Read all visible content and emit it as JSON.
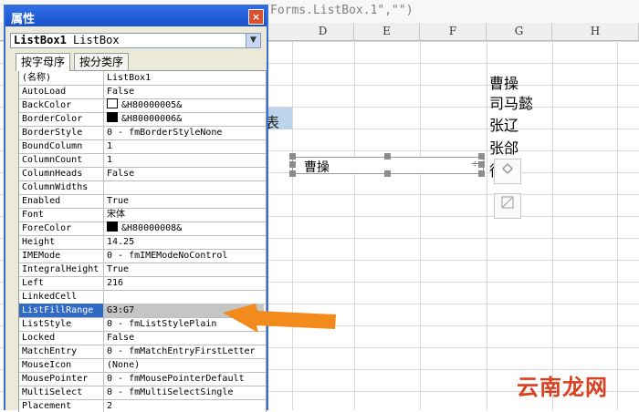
{
  "formula_bar": {
    "text": "Forms.ListBox.1\",\"\")"
  },
  "sheet": {
    "columns": [
      "D",
      "E",
      "F",
      "G",
      "H"
    ],
    "blue_cell_text": "表",
    "g_values": [
      "曹操",
      "司马懿",
      "张辽",
      "张郃",
      "徐"
    ],
    "listbox_value": "曹操",
    "listbox_spin": "÷"
  },
  "properties": {
    "title": "属性",
    "close": "×",
    "object_name": "ListBox1",
    "object_type": "ListBox",
    "tabs": [
      "按字母序",
      "按分类序"
    ],
    "rows": [
      {
        "name": "(名称)",
        "value": "ListBox1"
      },
      {
        "name": "AutoLoad",
        "value": "False"
      },
      {
        "name": "BackColor",
        "value": "&H80000005&",
        "swatch": "#ffffff"
      },
      {
        "name": "BorderColor",
        "value": "&H80000006&",
        "swatch": "#000000"
      },
      {
        "name": "BorderStyle",
        "value": "0 - fmBorderStyleNone"
      },
      {
        "name": "BoundColumn",
        "value": "1"
      },
      {
        "name": "ColumnCount",
        "value": "1"
      },
      {
        "name": "ColumnHeads",
        "value": "False"
      },
      {
        "name": "ColumnWidths",
        "value": ""
      },
      {
        "name": "Enabled",
        "value": "True"
      },
      {
        "name": "Font",
        "value": "宋体"
      },
      {
        "name": "ForeColor",
        "value": "&H80000008&",
        "swatch": "#000000"
      },
      {
        "name": "Height",
        "value": "14.25"
      },
      {
        "name": "IMEMode",
        "value": "0 - fmIMEModeNoControl"
      },
      {
        "name": "IntegralHeight",
        "value": "True"
      },
      {
        "name": "Left",
        "value": "216"
      },
      {
        "name": "LinkedCell",
        "value": ""
      },
      {
        "name": "ListFillRange",
        "value": "G3:G7",
        "selected": true
      },
      {
        "name": "ListStyle",
        "value": "0 - fmListStylePlain"
      },
      {
        "name": "Locked",
        "value": "False"
      },
      {
        "name": "MatchEntry",
        "value": "0 - fmMatchEntryFirstLetter"
      },
      {
        "name": "MouseIcon",
        "value": "(None)"
      },
      {
        "name": "MousePointer",
        "value": "0 - fmMousePointerDefault"
      },
      {
        "name": "MultiSelect",
        "value": "0 - fmMultiSelectSingle"
      },
      {
        "name": "Placement",
        "value": "2"
      }
    ]
  },
  "watermark": "云南龙网",
  "colors": {
    "arrow": "#f28a1c",
    "selection": "#316ac5",
    "title_bar": "#2f6fe6"
  }
}
